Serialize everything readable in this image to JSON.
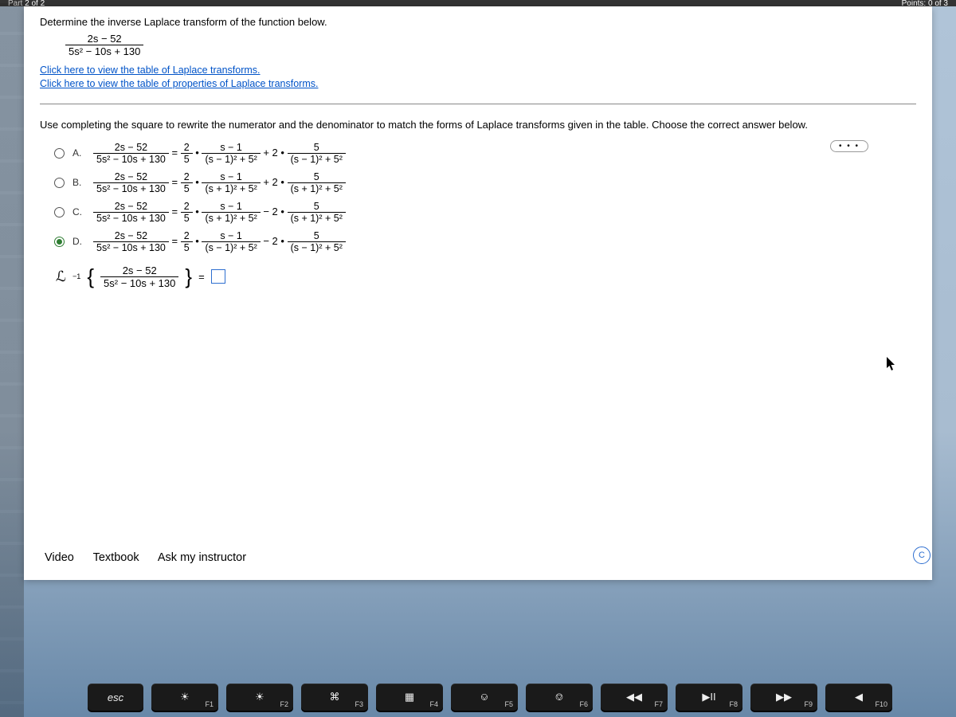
{
  "header": {
    "part_text": "Part 2 of 2",
    "points_text": "Points: 0 of 3"
  },
  "problem": {
    "prompt": "Determine the inverse Laplace transform of the function below.",
    "expr_num": "2s − 52",
    "expr_den": "5s² − 10s + 130",
    "link1": "Click here to view the table of Laplace transforms.",
    "link2": "Click here to view the table of properties of Laplace transforms."
  },
  "more_label": "• • •",
  "instruction": "Use completing the square to rewrite the numerator and the denominator to match the forms of Laplace transforms given in the table. Choose the correct answer below.",
  "lhs_num": "2s − 52",
  "lhs_den": "5s² − 10s + 130",
  "coef_num": "2",
  "coef_den": "5",
  "choices": [
    {
      "tag": "A.",
      "t1n": "s − 1",
      "t1d": "(s − 1)² + 5²",
      "op": "+ 2 •",
      "t2n": "5",
      "t2d": "(s − 1)² + 5²",
      "checked": false
    },
    {
      "tag": "B.",
      "t1n": "s − 1",
      "t1d": "(s + 1)² + 5²",
      "op": "+ 2 •",
      "t2n": "5",
      "t2d": "(s + 1)² + 5²",
      "checked": false
    },
    {
      "tag": "C.",
      "t1n": "s − 1",
      "t1d": "(s + 1)² + 5²",
      "op": "− 2 •",
      "t2n": "5",
      "t2d": "(s + 1)² + 5²",
      "checked": false
    },
    {
      "tag": "D.",
      "t1n": "s − 1",
      "t1d": "(s − 1)² + 5²",
      "op": "− 2 •",
      "t2n": "5",
      "t2d": "(s − 1)² + 5²",
      "checked": true
    }
  ],
  "answer": {
    "script": "ℒ",
    "sup": "−1",
    "inner_num": "2s − 52",
    "inner_den": "5s² − 10s + 130",
    "equals": "="
  },
  "help": {
    "video": "Video",
    "textbook": "Textbook",
    "ask": "Ask my instructor",
    "clear": "C"
  },
  "keys": {
    "esc": "esc",
    "f": [
      "F1",
      "F2",
      "F3",
      "F4",
      "F5",
      "F6",
      "F7",
      "F8",
      "F9",
      "F10"
    ],
    "icons": [
      "☀︎",
      "☀",
      "⌘",
      "▦",
      "⎉",
      "⎊",
      "◀◀",
      "▶II",
      "▶▶",
      "◀"
    ]
  }
}
